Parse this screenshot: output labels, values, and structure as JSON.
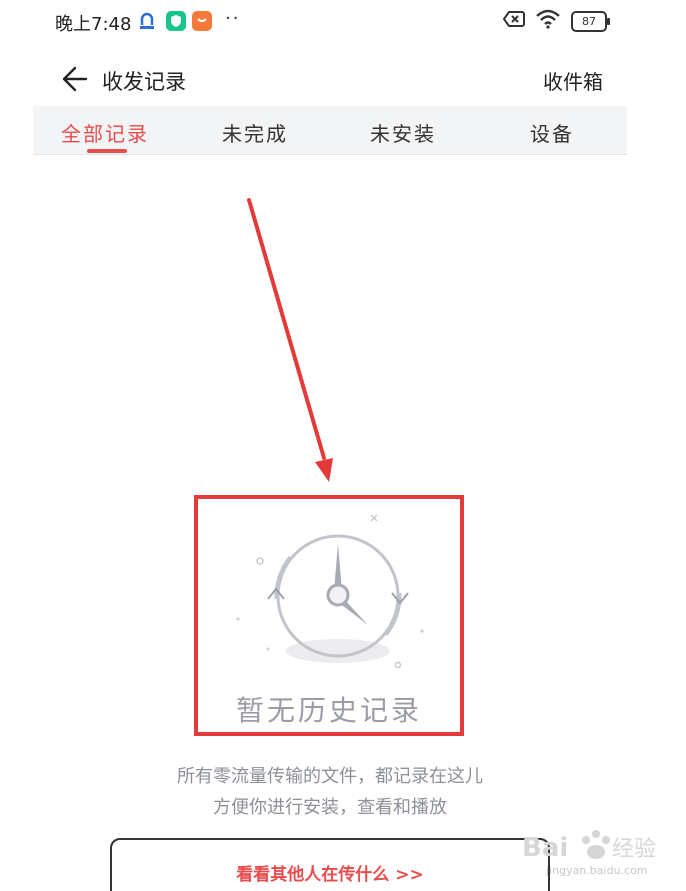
{
  "status_bar": {
    "time": "晚上7:48",
    "battery": "87",
    "more_dots": "··"
  },
  "header": {
    "title": "收发记录",
    "inbox_label": "收件箱"
  },
  "tabs": [
    {
      "label": "全部记录",
      "active": true
    },
    {
      "label": "未完成",
      "active": false
    },
    {
      "label": "未安装",
      "active": false
    },
    {
      "label": "设备",
      "active": false
    }
  ],
  "empty_state": {
    "title": "暂无历史记录",
    "description_line1": "所有零流量传输的文件，都记录在这儿",
    "description_line2": "方便你进行安装，查看和播放",
    "see_others_label": "看看其他人在传什么 >>"
  },
  "watermark": {
    "brand": "Bai du 经验",
    "url": "jingyan.baidu.com"
  },
  "colors": {
    "accent": "#e84c4c",
    "highlight_box": "#e53a3a",
    "tab_bar_bg": "#f3f4f6",
    "muted_text": "#8e9099"
  }
}
